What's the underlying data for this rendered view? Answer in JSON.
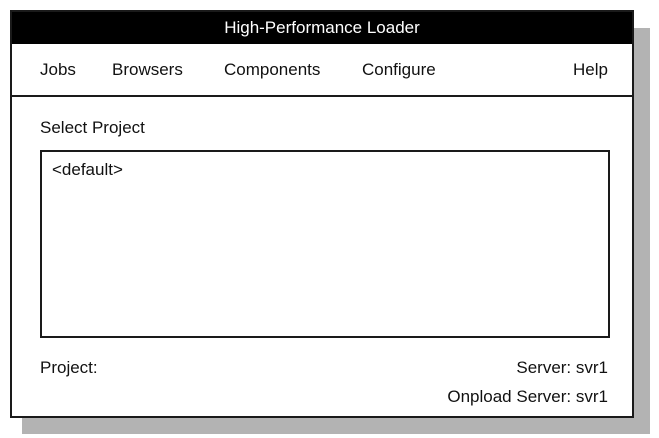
{
  "window": {
    "title": "High-Performance Loader"
  },
  "menu": {
    "items": [
      "Jobs",
      "Browsers",
      "Components",
      "Configure"
    ],
    "help": "Help"
  },
  "select_project": {
    "label": "Select Project",
    "items": [
      "<default>"
    ]
  },
  "footer": {
    "project": "Project:",
    "server": "Server: svr1",
    "onpload_server": "Onpload Server: svr1"
  },
  "colors": {
    "titlebar_background": "#000000",
    "titlebar_text": "#ffffff",
    "shadow": "#b3b3b3",
    "border": "#1a1a1a"
  }
}
